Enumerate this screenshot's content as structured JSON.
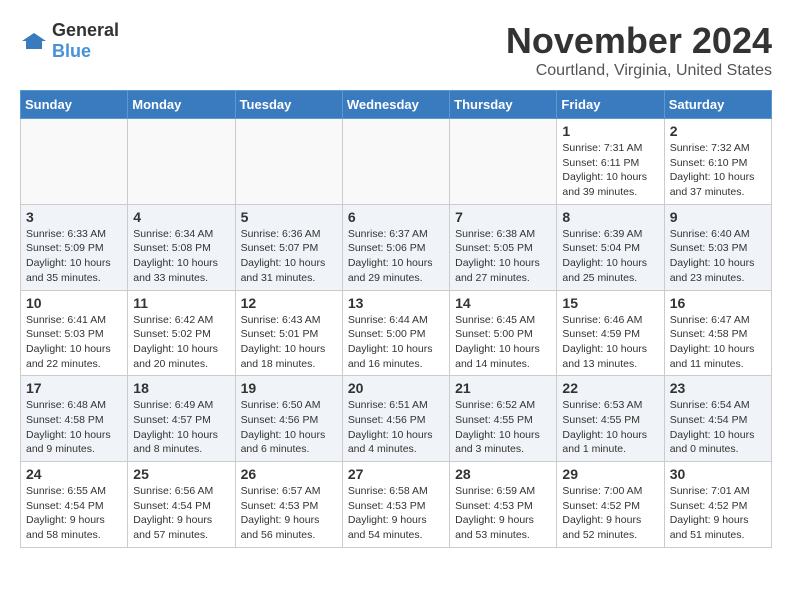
{
  "logo": {
    "general": "General",
    "blue": "Blue"
  },
  "title": "November 2024",
  "location": "Courtland, Virginia, United States",
  "headers": [
    "Sunday",
    "Monday",
    "Tuesday",
    "Wednesday",
    "Thursday",
    "Friday",
    "Saturday"
  ],
  "weeks": [
    [
      {
        "day": "",
        "info": ""
      },
      {
        "day": "",
        "info": ""
      },
      {
        "day": "",
        "info": ""
      },
      {
        "day": "",
        "info": ""
      },
      {
        "day": "",
        "info": ""
      },
      {
        "day": "1",
        "info": "Sunrise: 7:31 AM\nSunset: 6:11 PM\nDaylight: 10 hours and 39 minutes."
      },
      {
        "day": "2",
        "info": "Sunrise: 7:32 AM\nSunset: 6:10 PM\nDaylight: 10 hours and 37 minutes."
      }
    ],
    [
      {
        "day": "3",
        "info": "Sunrise: 6:33 AM\nSunset: 5:09 PM\nDaylight: 10 hours and 35 minutes."
      },
      {
        "day": "4",
        "info": "Sunrise: 6:34 AM\nSunset: 5:08 PM\nDaylight: 10 hours and 33 minutes."
      },
      {
        "day": "5",
        "info": "Sunrise: 6:36 AM\nSunset: 5:07 PM\nDaylight: 10 hours and 31 minutes."
      },
      {
        "day": "6",
        "info": "Sunrise: 6:37 AM\nSunset: 5:06 PM\nDaylight: 10 hours and 29 minutes."
      },
      {
        "day": "7",
        "info": "Sunrise: 6:38 AM\nSunset: 5:05 PM\nDaylight: 10 hours and 27 minutes."
      },
      {
        "day": "8",
        "info": "Sunrise: 6:39 AM\nSunset: 5:04 PM\nDaylight: 10 hours and 25 minutes."
      },
      {
        "day": "9",
        "info": "Sunrise: 6:40 AM\nSunset: 5:03 PM\nDaylight: 10 hours and 23 minutes."
      }
    ],
    [
      {
        "day": "10",
        "info": "Sunrise: 6:41 AM\nSunset: 5:03 PM\nDaylight: 10 hours and 22 minutes."
      },
      {
        "day": "11",
        "info": "Sunrise: 6:42 AM\nSunset: 5:02 PM\nDaylight: 10 hours and 20 minutes."
      },
      {
        "day": "12",
        "info": "Sunrise: 6:43 AM\nSunset: 5:01 PM\nDaylight: 10 hours and 18 minutes."
      },
      {
        "day": "13",
        "info": "Sunrise: 6:44 AM\nSunset: 5:00 PM\nDaylight: 10 hours and 16 minutes."
      },
      {
        "day": "14",
        "info": "Sunrise: 6:45 AM\nSunset: 5:00 PM\nDaylight: 10 hours and 14 minutes."
      },
      {
        "day": "15",
        "info": "Sunrise: 6:46 AM\nSunset: 4:59 PM\nDaylight: 10 hours and 13 minutes."
      },
      {
        "day": "16",
        "info": "Sunrise: 6:47 AM\nSunset: 4:58 PM\nDaylight: 10 hours and 11 minutes."
      }
    ],
    [
      {
        "day": "17",
        "info": "Sunrise: 6:48 AM\nSunset: 4:58 PM\nDaylight: 10 hours and 9 minutes."
      },
      {
        "day": "18",
        "info": "Sunrise: 6:49 AM\nSunset: 4:57 PM\nDaylight: 10 hours and 8 minutes."
      },
      {
        "day": "19",
        "info": "Sunrise: 6:50 AM\nSunset: 4:56 PM\nDaylight: 10 hours and 6 minutes."
      },
      {
        "day": "20",
        "info": "Sunrise: 6:51 AM\nSunset: 4:56 PM\nDaylight: 10 hours and 4 minutes."
      },
      {
        "day": "21",
        "info": "Sunrise: 6:52 AM\nSunset: 4:55 PM\nDaylight: 10 hours and 3 minutes."
      },
      {
        "day": "22",
        "info": "Sunrise: 6:53 AM\nSunset: 4:55 PM\nDaylight: 10 hours and 1 minute."
      },
      {
        "day": "23",
        "info": "Sunrise: 6:54 AM\nSunset: 4:54 PM\nDaylight: 10 hours and 0 minutes."
      }
    ],
    [
      {
        "day": "24",
        "info": "Sunrise: 6:55 AM\nSunset: 4:54 PM\nDaylight: 9 hours and 58 minutes."
      },
      {
        "day": "25",
        "info": "Sunrise: 6:56 AM\nSunset: 4:54 PM\nDaylight: 9 hours and 57 minutes."
      },
      {
        "day": "26",
        "info": "Sunrise: 6:57 AM\nSunset: 4:53 PM\nDaylight: 9 hours and 56 minutes."
      },
      {
        "day": "27",
        "info": "Sunrise: 6:58 AM\nSunset: 4:53 PM\nDaylight: 9 hours and 54 minutes."
      },
      {
        "day": "28",
        "info": "Sunrise: 6:59 AM\nSunset: 4:53 PM\nDaylight: 9 hours and 53 minutes."
      },
      {
        "day": "29",
        "info": "Sunrise: 7:00 AM\nSunset: 4:52 PM\nDaylight: 9 hours and 52 minutes."
      },
      {
        "day": "30",
        "info": "Sunrise: 7:01 AM\nSunset: 4:52 PM\nDaylight: 9 hours and 51 minutes."
      }
    ]
  ]
}
